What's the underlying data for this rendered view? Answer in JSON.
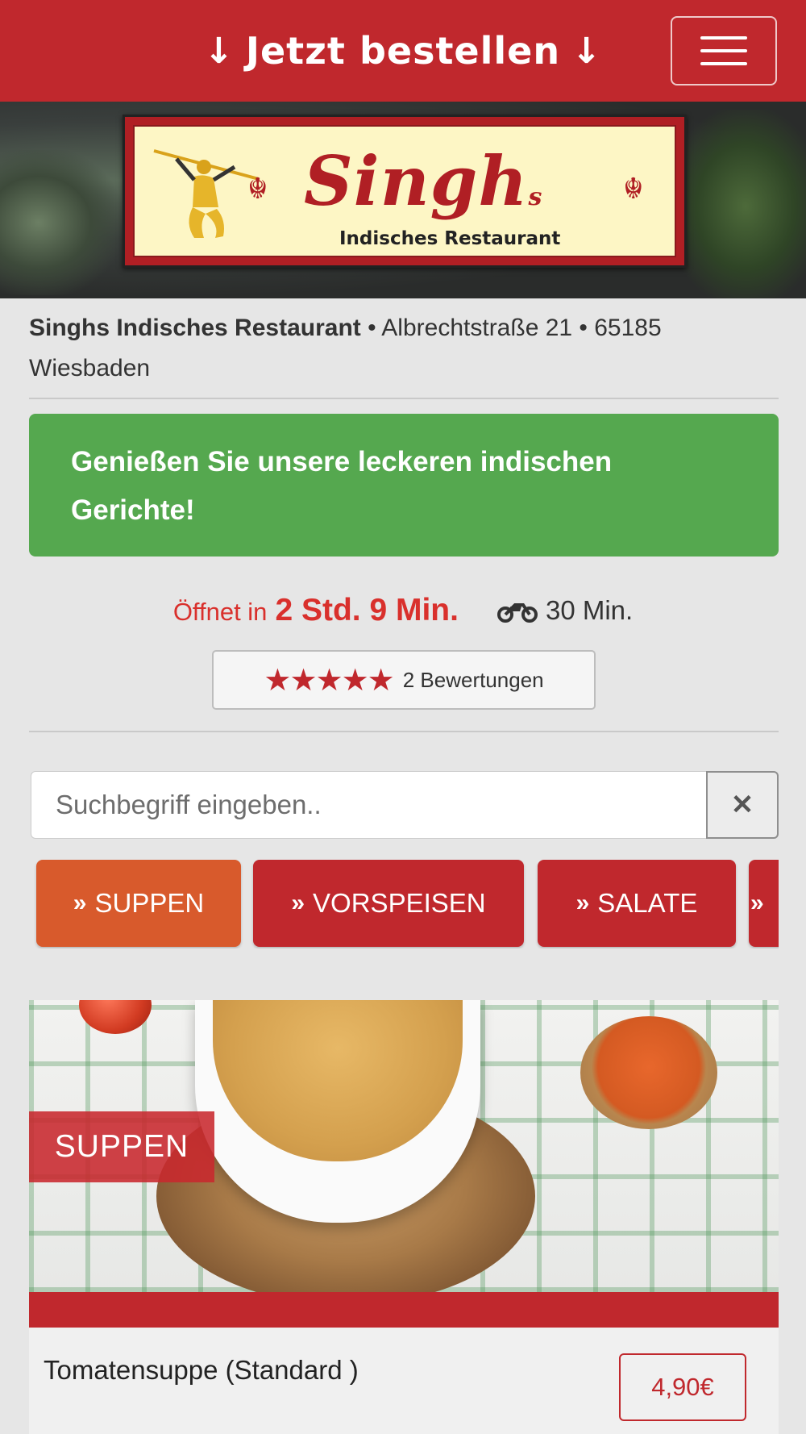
{
  "header": {
    "order_label": "Jetzt bestellen",
    "arrow_glyph": "↓",
    "menu_icon": "hamburger-icon"
  },
  "banner": {
    "logo_name": "Singh",
    "logo_suffix": "s",
    "logo_subtitle": "Indisches Restaurant"
  },
  "restaurant": {
    "name": "Singhs Indisches Restaurant",
    "address": " • Albrechtstraße 21 • 65185 Wiesbaden"
  },
  "promo": {
    "text": "Genießen Sie unsere leckeren indischen Gerichte!"
  },
  "status": {
    "opens_prefix": "Öffnet in",
    "opens_time": "2 Std. 9 Min.",
    "delivery_icon": "motorcycle-icon",
    "delivery_time": "30 Min."
  },
  "reviews": {
    "stars": "★★★★★",
    "rating": 5,
    "count_label": "2 Bewertungen"
  },
  "search": {
    "placeholder": "Suchbegriff eingeben..",
    "clear_glyph": "✕"
  },
  "categories": [
    {
      "label": "SUPPEN",
      "active": true
    },
    {
      "label": "VORSPEISEN",
      "active": false
    },
    {
      "label": "SALATE",
      "active": false
    }
  ],
  "category_chevron": "»",
  "section": {
    "label": "SUPPEN"
  },
  "menu_items": [
    {
      "name": "Tomatensuppe (Standard )",
      "price": "4,90€"
    }
  ],
  "colors": {
    "brand_red": "#c0282d",
    "promo_green": "#55a84f",
    "active_category": "#d85a2c",
    "open_time_red": "#d9302c"
  }
}
